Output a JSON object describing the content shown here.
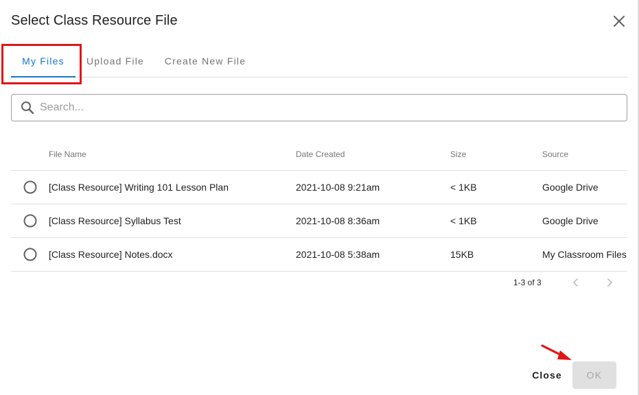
{
  "dialog": {
    "title": "Select Class Resource File"
  },
  "tabs": [
    {
      "label": "My Files",
      "active": true
    },
    {
      "label": "Upload File",
      "active": false
    },
    {
      "label": "Create New File",
      "active": false
    }
  ],
  "search": {
    "placeholder": "Search...",
    "value": ""
  },
  "table": {
    "columns": [
      "File Name",
      "Date Created",
      "Size",
      "Source"
    ],
    "rows": [
      {
        "name": "[Class Resource] Writing 101 Lesson Plan",
        "date": "2021-10-08 9:21am",
        "size": "< 1KB",
        "source": "Google Drive"
      },
      {
        "name": "[Class Resource] Syllabus Test",
        "date": "2021-10-08 8:36am",
        "size": "< 1KB",
        "source": "Google Drive"
      },
      {
        "name": "[Class Resource] Notes.docx",
        "date": "2021-10-08 5:38am",
        "size": "15KB",
        "source": "My Classroom Files"
      }
    ]
  },
  "pagination": {
    "range": "1-3 of 3"
  },
  "actions": {
    "close_label": "Close",
    "ok_label": "OK"
  },
  "colors": {
    "accent": "#1976d2",
    "annotation_red": "#e01515",
    "disabled_button_bg": "#e0e0e0"
  },
  "icons": {
    "close": "close-icon",
    "search": "search-icon",
    "radio": "radio-unchecked-icon",
    "prev": "chevron-left-icon",
    "next": "chevron-right-icon",
    "annotation": "red-arrow-icon"
  }
}
